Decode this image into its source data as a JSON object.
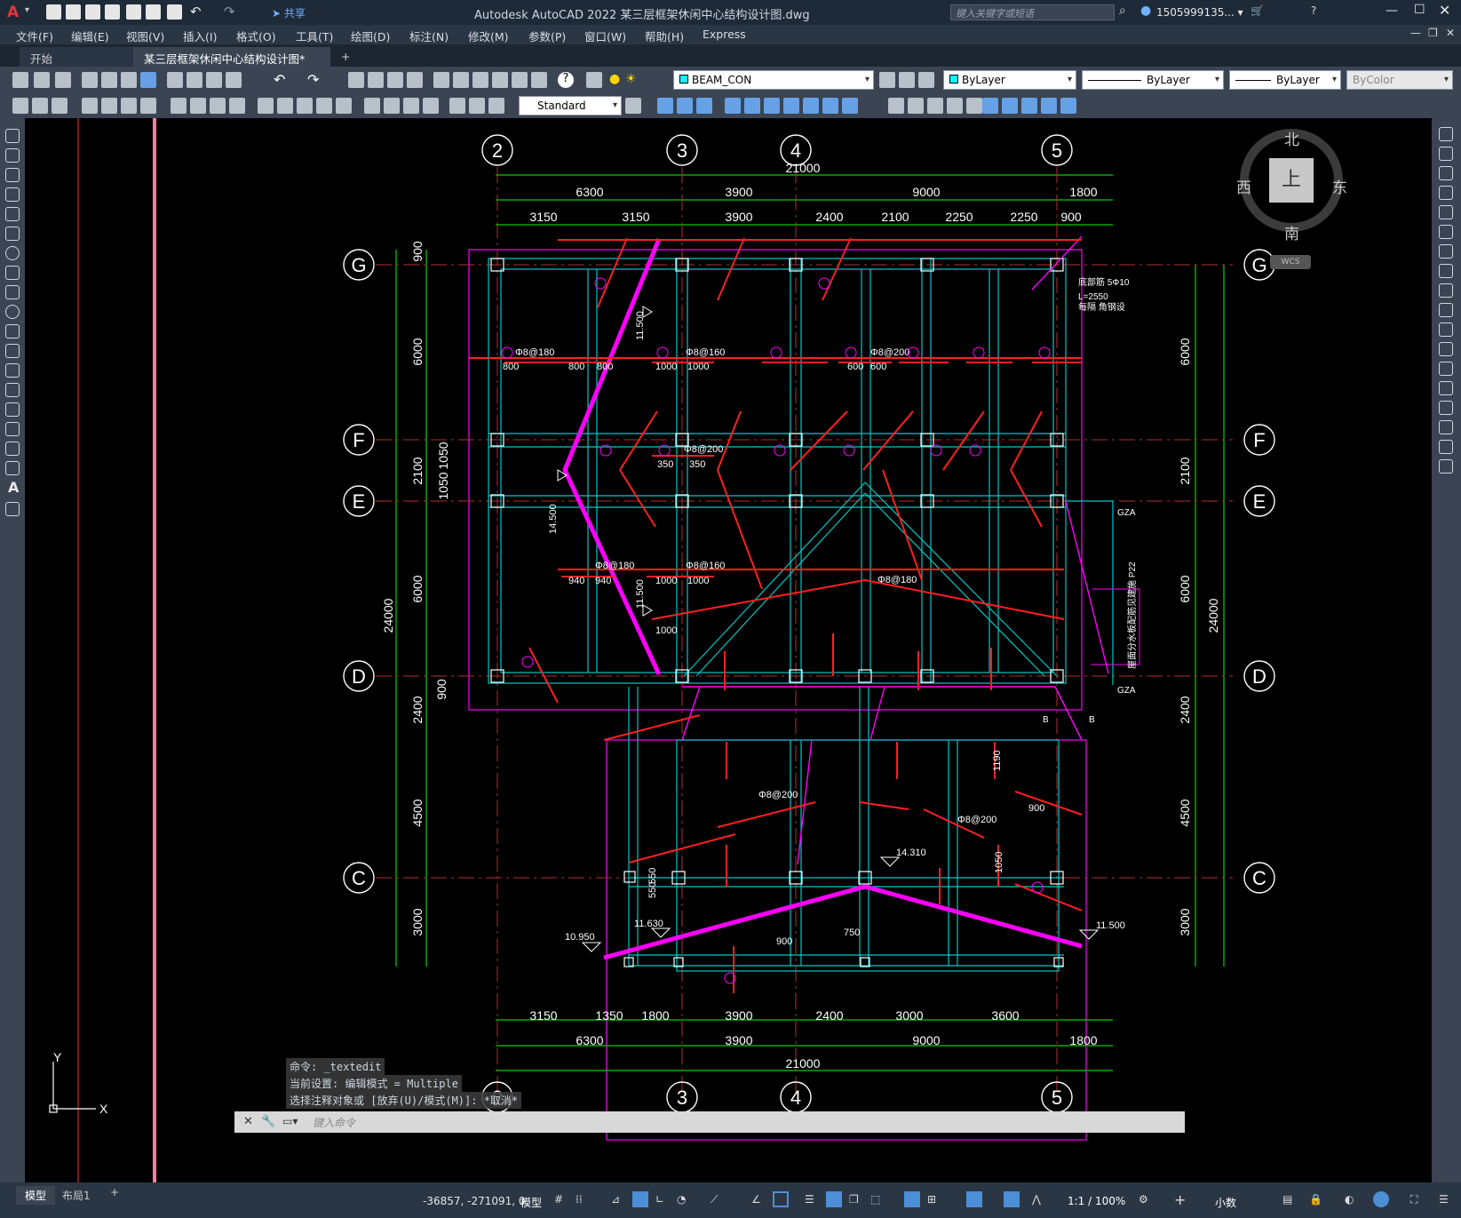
{
  "app": {
    "title": "Autodesk AutoCAD 2022    某三层框架休闲中心结构设计图.dwg",
    "search_placeholder": "键入关键字或短语",
    "user": "1505999135... ▾",
    "share": "共享"
  },
  "menu": [
    "文件(F)",
    "编辑(E)",
    "视图(V)",
    "插入(I)",
    "格式(O)",
    "工具(T)",
    "绘图(D)",
    "标注(N)",
    "修改(M)",
    "参数(P)",
    "窗口(W)",
    "帮助(H)",
    "Express"
  ],
  "tabs": [
    {
      "label": "开始",
      "active": false
    },
    {
      "label": "某三层框架休闲中心结构设计图*",
      "active": true
    },
    {
      "label": "+",
      "active": false
    }
  ],
  "toolbar": {
    "layer": "BEAM_CON",
    "color": "ByLayer",
    "linetype": "ByLayer",
    "lineweight": "ByLayer",
    "plotstyle": "ByColor",
    "textstyle": "Standard"
  },
  "viewcube": {
    "north": "北",
    "south": "南",
    "east": "东",
    "west": "西",
    "face": "上",
    "wcs": "WCS"
  },
  "drawing": {
    "grid_cols": [
      "2",
      "3",
      "4",
      "5"
    ],
    "grid_rows": [
      "G",
      "F",
      "E",
      "D",
      "C"
    ],
    "top_dims": {
      "overall": "21000",
      "row1": [
        "6300",
        "3900",
        "9000",
        "1800"
      ],
      "row2": [
        "3150",
        "3150",
        "3900",
        "2400",
        "2100",
        "2250",
        "2250",
        "900"
      ]
    },
    "bottom_dims": {
      "row1": [
        "3150",
        "1350",
        "1800",
        "3900",
        "2400",
        "3000",
        "3600"
      ],
      "row2": [
        "6300",
        "3900",
        "9000",
        "1800"
      ],
      "overall": "21000"
    },
    "left_dims": {
      "overall": "24000",
      "segments": [
        "900",
        "6000",
        "2100",
        "6000",
        "900",
        "2400",
        "4500",
        "3000"
      ],
      "inner": [
        "1050",
        "1050"
      ]
    },
    "right_dims": {
      "overall": "24000",
      "segments": [
        "6000",
        "2100",
        "6000",
        "2400",
        "4500",
        "3000"
      ]
    },
    "elevations": [
      "11.500",
      "14.500",
      "11.500",
      "14.310",
      "10.950",
      "11.630",
      "11.500"
    ],
    "rebar_labels": [
      "Φ8@180",
      "Φ8@160",
      "Φ8@200",
      "Φ8@180",
      "Φ8@200",
      "Φ8@160",
      "Φ8@200",
      "Φ8@180",
      "Φ8@200"
    ],
    "annotations": [
      "GZA",
      "GZA",
      "B",
      "B",
      "底部筋 5Φ10",
      "L=2550",
      "每隔 角钢设",
      "屋面分水板配筋见建施 P22"
    ],
    "lengths": [
      "800",
      "800",
      "800",
      "1000",
      "1000",
      "600",
      "600",
      "350",
      "350",
      "940",
      "940",
      "1000",
      "1000",
      "900",
      "1000",
      "750",
      "1190",
      "550",
      "550",
      "1050",
      "900"
    ]
  },
  "command": {
    "history": [
      "命令: _textedit",
      "当前设置: 编辑模式 = Multiple",
      "选择注释对象或 [放弃(U)/模式(M)]: *取消*"
    ],
    "prompt": "键入命令"
  },
  "status": {
    "model_tab": "模型",
    "layout_tab": "布局1",
    "coords": "-36857, -271091, 0",
    "mode": "模型",
    "scale": "1:1 / 100%",
    "units": "小数"
  },
  "colors": {
    "axis": "#00ff00",
    "rebar": "#ff0000",
    "beam": "#00c8c8",
    "ridge": "#ff00ff",
    "grid_bubble": "#ffffff"
  }
}
